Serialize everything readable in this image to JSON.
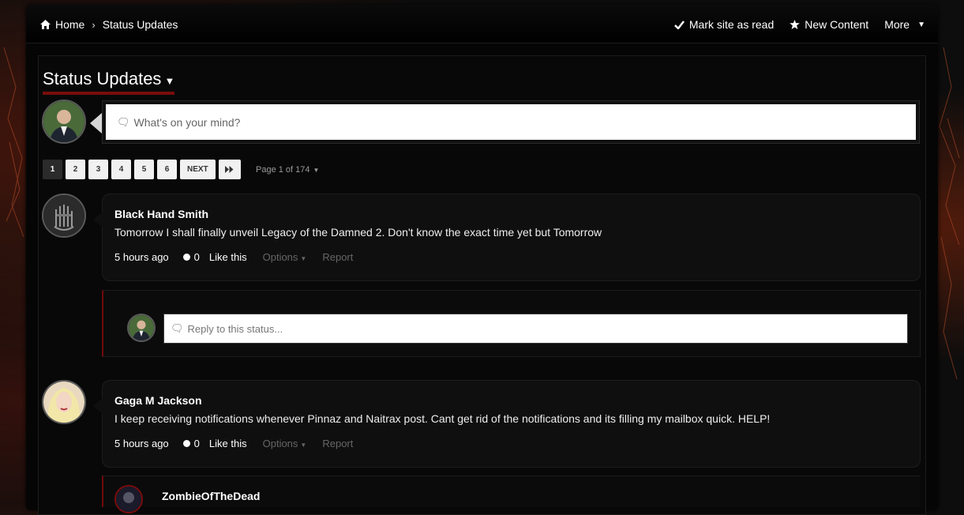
{
  "breadcrumb": {
    "home": "Home",
    "current": "Status Updates"
  },
  "nav": {
    "mark_read": "Mark site as read",
    "new_content": "New Content",
    "more": "More"
  },
  "page": {
    "title": "Status Updates"
  },
  "composer": {
    "placeholder": "What's on your mind?"
  },
  "pagination": {
    "pages": [
      "1",
      "2",
      "3",
      "4",
      "5",
      "6"
    ],
    "active": "1",
    "next": "NEXT",
    "page_of": "Page 1 of 174"
  },
  "statuses": [
    {
      "author": "Black Hand Smith",
      "message": "Tomorrow I shall finally unveil Legacy of the Damned 2. Don't know the exact time yet but Tomorrow",
      "time": "5 hours ago",
      "reactions": "0",
      "like": "Like this",
      "options": "Options",
      "report": "Report",
      "reply_placeholder": "Reply to this status..."
    },
    {
      "author": "Gaga M Jackson",
      "message": "I keep receiving notifications whenever Pinnaz and Naitrax post.  Cant get rid of the notifications and its filling my mailbox quick.  HELP!",
      "time": "5 hours ago",
      "reactions": "0",
      "like": "Like this",
      "options": "Options",
      "report": "Report",
      "reply_author": "ZombieOfTheDead"
    }
  ],
  "icons": {
    "home": "home-icon",
    "check": "check-icon",
    "star": "star-icon",
    "caret": "caret-down-icon",
    "comment": "comment-icon",
    "fast_forward": "fast-forward-icon"
  },
  "colors": {
    "accent": "#7a0d0d",
    "background": "#050505",
    "card": "#0f0f0f"
  }
}
